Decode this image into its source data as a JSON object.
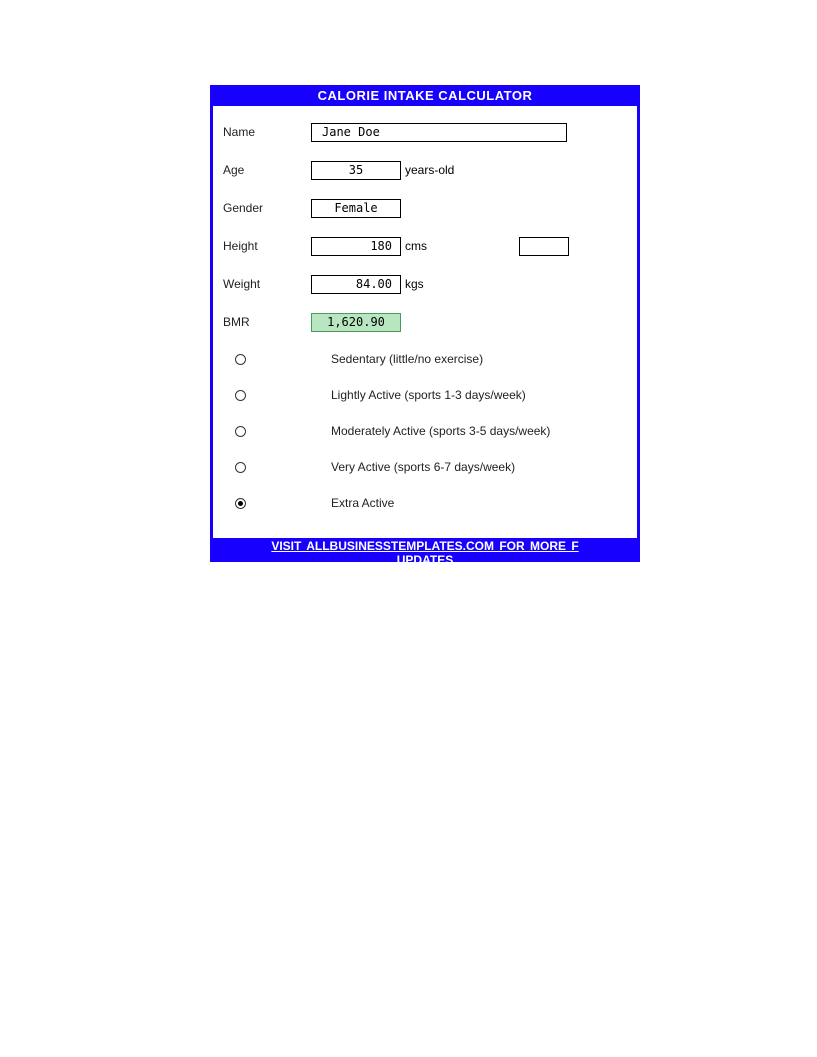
{
  "header": {
    "title": "CALORIE INTAKE CALCULATOR"
  },
  "fields": {
    "name_label": "Name",
    "name_value": "Jane Doe",
    "age_label": "Age",
    "age_value": "35",
    "age_unit": "years-old",
    "gender_label": "Gender",
    "gender_value": "Female",
    "height_label": "Height",
    "height_value": "180",
    "height_unit": "cms",
    "weight_label": "Weight",
    "weight_value": "84.00",
    "weight_unit": "kgs",
    "bmr_label": "BMR",
    "bmr_value": "1,620.90"
  },
  "activity": {
    "options": [
      {
        "label": "Sedentary (little/no exercise)",
        "selected": false
      },
      {
        "label": "Lightly Active (sports 1-3 days/week)",
        "selected": false
      },
      {
        "label": "Moderately Active (sports 3-5 days/week)",
        "selected": false
      },
      {
        "label": "Very Active (sports 6-7 days/week)",
        "selected": false
      },
      {
        "label": "Extra Active",
        "selected": true
      }
    ]
  },
  "footer": {
    "line1": "VISIT ALLBUSINESSTEMPLATES.COM FOR MORE F",
    "line2": "UPDATES"
  }
}
